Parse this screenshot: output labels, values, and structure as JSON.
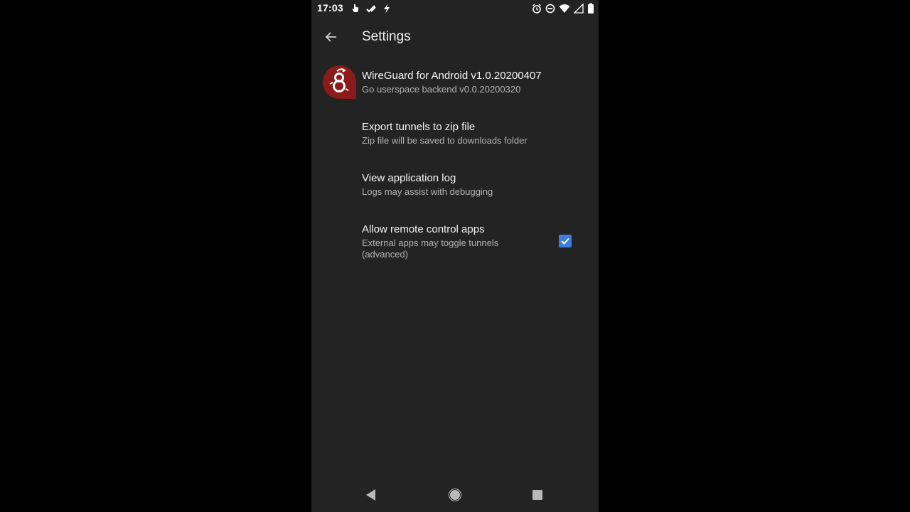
{
  "status_bar": {
    "time": "17:03",
    "left_icons": [
      "touch-icon",
      "check-icon",
      "flash-icon"
    ],
    "right_icons": [
      "alarm-icon",
      "do-not-disturb-icon",
      "wifi-icon",
      "signal-icon",
      "battery-icon"
    ]
  },
  "app_bar": {
    "title": "Settings",
    "back_icon": "arrow-back-icon"
  },
  "settings": {
    "version": {
      "title": "WireGuard for Android v1.0.20200407",
      "summary": "Go userspace backend v0.0.20200320",
      "icon": "wireguard-logo"
    },
    "export": {
      "title": "Export tunnels to zip file",
      "summary": "Zip file will be saved to downloads folder"
    },
    "log": {
      "title": "View application log",
      "summary": "Logs may assist with debugging"
    },
    "remote": {
      "title": "Allow remote control apps",
      "summary": "External apps may toggle tunnels (advanced)",
      "checked": true
    }
  },
  "nav_bar": {
    "buttons": [
      "back-triangle-icon",
      "home-circle-icon",
      "recents-square-icon"
    ]
  },
  "colors": {
    "background": "#232323",
    "accent": "#3d7de0",
    "logo_red": "#8b1a1a"
  }
}
